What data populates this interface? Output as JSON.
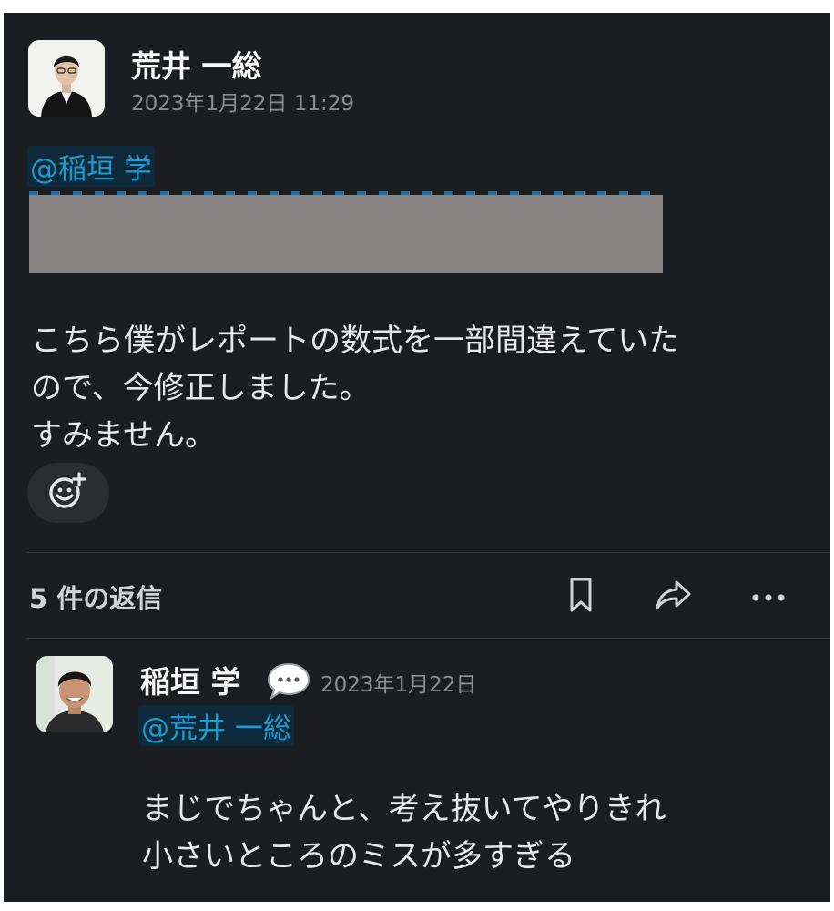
{
  "post": {
    "author": "荒井 一総",
    "timestamp": "2023年1月22日 11:29",
    "mention": "@稲垣 学",
    "message_lines": [
      "こちら僕がレポートの数式を一部間違えていた",
      "ので、今修正しました。",
      "すみません。"
    ]
  },
  "thread": {
    "replies_label": "5 件の返信"
  },
  "reply": {
    "author": "稲垣 学",
    "timestamp": "2023年1月22日",
    "mention": "@荒井 一総",
    "message_lines": [
      "まじでちゃんと、考え抜いてやりきれ",
      "小さいところのミスが多すぎる"
    ]
  },
  "icons": [
    "add-reaction-icon",
    "bookmark-icon",
    "share-icon",
    "more-icon",
    "speech-bubble-icon"
  ],
  "colors": {
    "background": "#1b1d21",
    "mention": "#1d9bd1",
    "text": "#e8e8e8"
  }
}
